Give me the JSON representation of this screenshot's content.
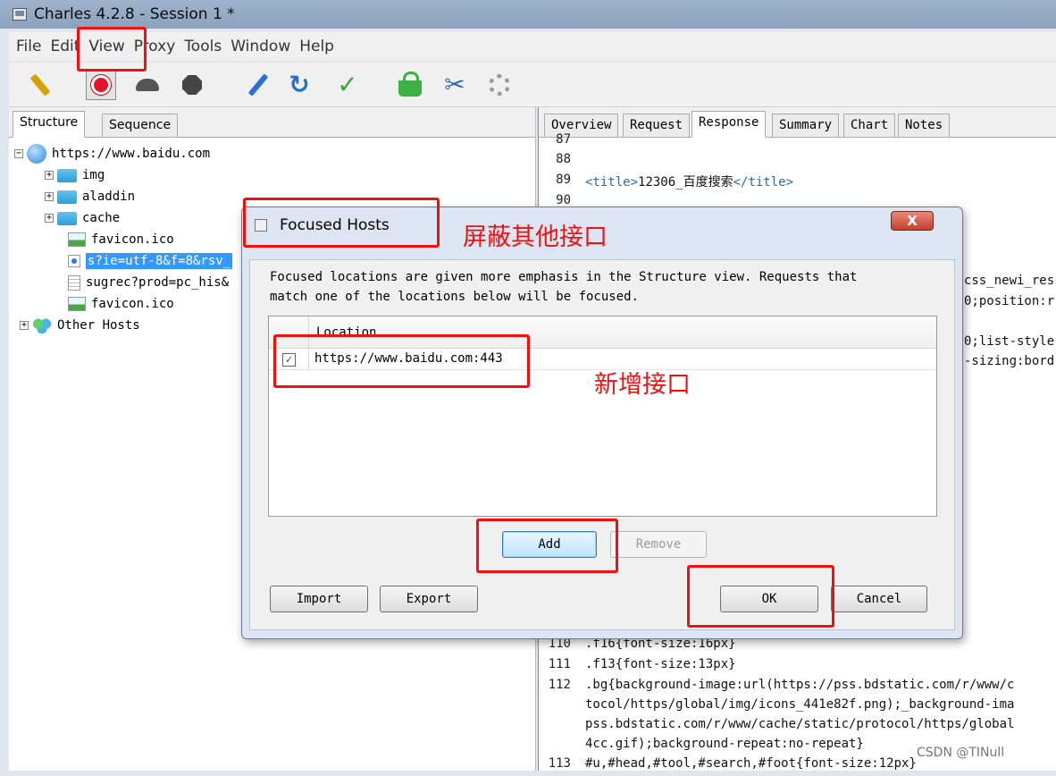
{
  "window": {
    "title": "Charles 4.2.8 - Session 1 *"
  },
  "menu": [
    "File",
    "Edit",
    "View",
    "Proxy",
    "Tools",
    "Window",
    "Help"
  ],
  "left_tabs": [
    "Structure",
    "Sequence"
  ],
  "tree": {
    "root": "https://www.baidu.com",
    "items": [
      "img",
      "aladdin",
      "cache",
      "favicon.ico",
      "s?ie=utf-8&f=8&rsv_",
      "sugrec?prod=pc_his&",
      "favicon.ico"
    ],
    "other_hosts": "Other Hosts"
  },
  "right_tabs": [
    "Overview",
    "Request",
    "Response",
    "Summary",
    "Chart",
    "Notes"
  ],
  "code": {
    "top": [
      {
        "n": "87",
        "t": ""
      },
      {
        "n": "88",
        "t": ""
      },
      {
        "n": "89",
        "open": "<title>",
        "text": "12306_百度搜索",
        "close": "</title>"
      },
      {
        "n": "90",
        "t": ""
      }
    ],
    "peek": [
      "css_newi_res",
      "0;position:r",
      "0;list-style",
      "-sizing:bord"
    ],
    "bottom": [
      {
        "n": "110",
        "t": ".f16{font-size:16px}"
      },
      {
        "n": "111",
        "t": ".f13{font-size:13px}"
      },
      {
        "n": "112",
        "t": ".bg{background-image:url(https://pss.bdstatic.com/r/www/c"
      },
      {
        "n": "",
        "t": "tocol/https/global/img/icons_441e82f.png);_background-ima"
      },
      {
        "n": "",
        "t": "pss.bdstatic.com/r/www/cache/static/protocol/https/global"
      },
      {
        "n": "",
        "t": "4cc.gif);background-repeat:no-repeat}"
      },
      {
        "n": "113",
        "t": "#u,#head,#tool,#search,#foot{font-size:12px}"
      }
    ]
  },
  "dialog": {
    "title": "Focused Hosts",
    "close": "X",
    "description_line1": "Focused locations are given more emphasis in the Structure view.  Requests that",
    "description_line2": "match one of the locations below will be focused.",
    "column": "Location",
    "rows": [
      {
        "checked": "✓",
        "location": "https://www.baidu.com:443"
      }
    ],
    "add": "Add",
    "remove": "Remove",
    "import": "Import",
    "export": "Export",
    "ok": "OK",
    "cancel": "Cancel"
  },
  "annotations": {
    "block_other": "屏蔽其他接口",
    "add_new": "新增接口"
  },
  "watermark": "CSDN @TINull",
  "colors": {
    "annotation": "#f01010",
    "selection": "#3399ff",
    "record": "#e8112d"
  }
}
